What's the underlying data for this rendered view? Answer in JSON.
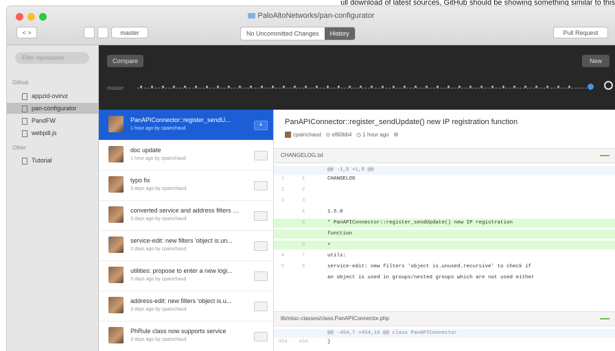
{
  "caption": "ull download of latest sources, GitHub should be showing something similar to this",
  "window": {
    "title": "PaloAltoNetworks/pan-configurator",
    "branch": "master",
    "tabs": [
      {
        "label": "No Uncommitted Changes"
      },
      {
        "label": "History"
      }
    ],
    "pull_request": "Pull Request",
    "sync_back": "<  >"
  },
  "sidebar": {
    "filter_placeholder": "Filter repositories",
    "sections": [
      {
        "label": "Github",
        "items": [
          "appzid-ovirvz",
          "pan-configurator",
          "PandFW",
          "webpill.js"
        ]
      },
      {
        "label": "Other",
        "items": [
          "Tutorial"
        ]
      }
    ]
  },
  "graph": {
    "compare": "Compare",
    "new": "New",
    "branch_label": "master"
  },
  "commits": [
    {
      "title": "PanAPIConnector::register_sendU...",
      "meta": "1 hour ago by cpainchaud",
      "badge": "4"
    },
    {
      "title": "doc update",
      "meta": "1 hour ago by cpainchaud",
      "badge": ""
    },
    {
      "title": "typo fix",
      "meta": "3 days ago by cpainchaud",
      "badge": ""
    },
    {
      "title": "converted service and address filters to l...",
      "meta": "3 days ago by cpainchaud",
      "badge": ""
    },
    {
      "title": "service-edit: new filters 'object is.un...",
      "meta": "3 days ago by cpainchaud",
      "badge": ""
    },
    {
      "title": "utilities: propose to enter a new logi...",
      "meta": "3 days ago by cpainchaud",
      "badge": ""
    },
    {
      "title": "address-edit: new filters 'object is.u...",
      "meta": "3 days ago by cpainchaud",
      "badge": ""
    },
    {
      "title": "PhRule class now supports service",
      "meta": "3 days ago by cpainchaud",
      "badge": ""
    }
  ],
  "detail": {
    "title": "PanAPIConnector::register_sendUpdate() new IP registration function",
    "author": "cpainchaud",
    "sha": "ef60bb4",
    "time": "1 hour ago",
    "file1": "CHANGELOG.txt",
    "hunk1": "@@ -1,5 +1,8 @@",
    "lines1": [
      {
        "n1": "1",
        "n2": "1",
        "text": "CHANGELOG",
        "type": "ctx"
      },
      {
        "n1": "2",
        "n2": "2",
        "text": "",
        "type": "ctx"
      },
      {
        "n1": "3",
        "n2": "3",
        "text": "",
        "type": "ctx"
      },
      {
        "n1": "",
        "n2": "4",
        "text": "1.5.0",
        "type": "ctx"
      },
      {
        "n1": "",
        "n2": "5",
        "text": "* PanAPIConnector::register_sendUpdate() new IP registration",
        "type": "add"
      },
      {
        "n1": "",
        "n2": "",
        "text": "function",
        "type": "add"
      },
      {
        "n1": "",
        "n2": "6",
        "text": "+",
        "type": "add"
      },
      {
        "n1": "4",
        "n2": "7",
        "text": "utils:",
        "type": "ctx"
      },
      {
        "n1": "5",
        "n2": "8",
        "text": "service-edit: new filters 'object is.unused.recursive' to check if",
        "type": "ctx"
      },
      {
        "n1": "",
        "n2": "",
        "text": "an object is used in groups/nested groups which are not used either",
        "type": "ctx"
      }
    ],
    "file2": "lib/misc-classes/class.PanAPIConnector.php",
    "hunk2": "@@ -454,7 +454,16 @@ class PanAPIConnector",
    "lines2": [
      {
        "n1": "454",
        "n2": "454",
        "text": "}",
        "type": "ctx"
      }
    ]
  }
}
